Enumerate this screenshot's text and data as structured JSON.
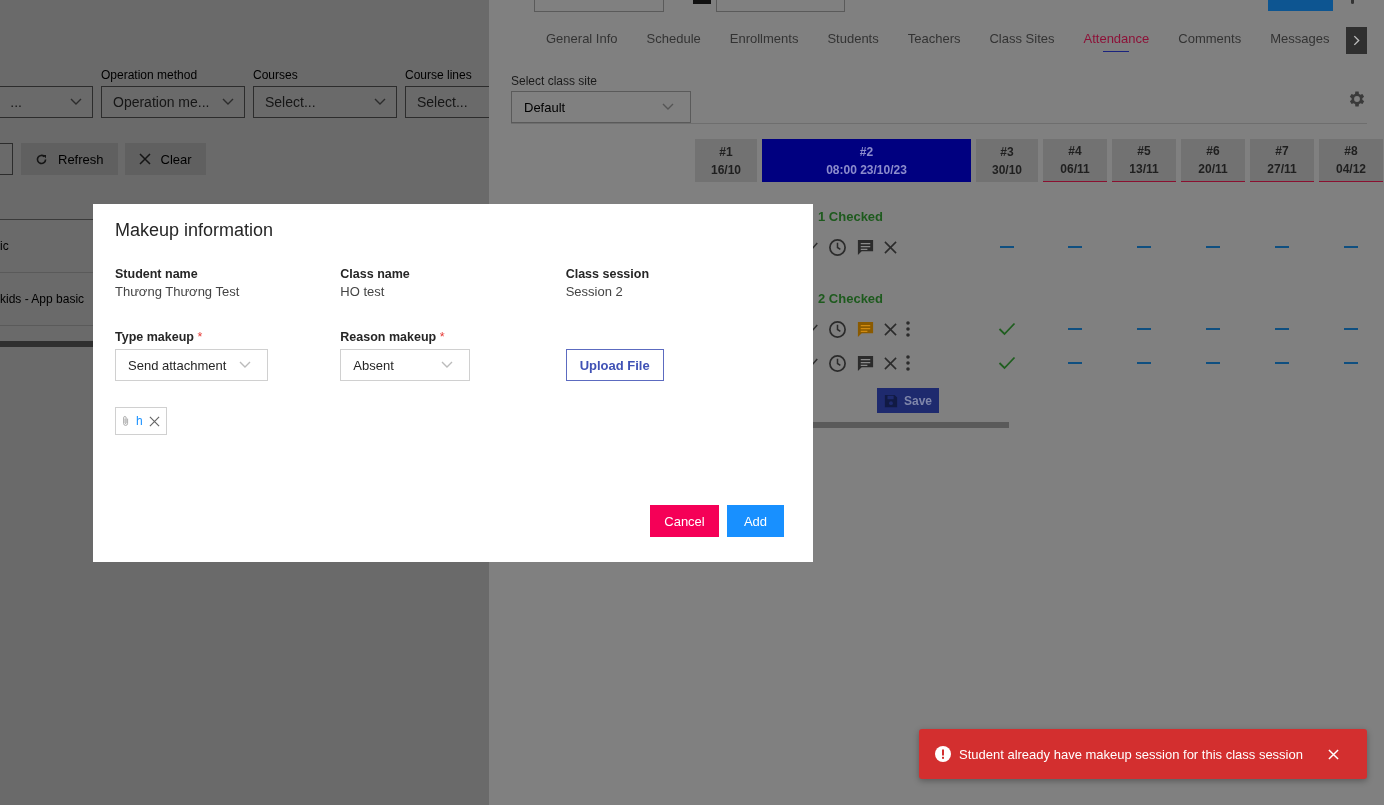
{
  "left_panel": {
    "filters": [
      {
        "placeholder": "..."
      },
      {
        "label": "Operation method",
        "placeholder": "Operation me..."
      },
      {
        "label": "Courses",
        "placeholder": "Select..."
      },
      {
        "label": "Course lines",
        "placeholder": "Select..."
      }
    ],
    "buttons": [
      {
        "kind": "refresh",
        "label": "Refresh"
      },
      {
        "kind": "clear",
        "label": "Clear"
      }
    ],
    "table": {
      "rows": [
        "ic",
        "kids - App basic"
      ]
    }
  },
  "right_panel": {
    "tabs": [
      {
        "label": "General Info",
        "selected": false
      },
      {
        "label": "Schedule",
        "selected": false
      },
      {
        "label": "Enrollments",
        "selected": false
      },
      {
        "label": "Students",
        "selected": false
      },
      {
        "label": "Teachers",
        "selected": false
      },
      {
        "label": "Class Sites",
        "selected": false
      },
      {
        "label": "Attendance",
        "selected": true
      },
      {
        "label": "Comments",
        "selected": false
      },
      {
        "label": "Messages",
        "selected": false
      }
    ],
    "class_site": {
      "label": "Select class site",
      "value": "Default"
    },
    "sessions": [
      {
        "number": "#1",
        "date": "16/10",
        "selected": false,
        "upcoming": false
      },
      {
        "number": "#2",
        "date": "08:00 23/10/23",
        "selected": true,
        "upcoming": false
      },
      {
        "number": "#3",
        "date": "30/10",
        "selected": false,
        "upcoming": false
      },
      {
        "number": "#4",
        "date": "06/11",
        "selected": false,
        "upcoming": true
      },
      {
        "number": "#5",
        "date": "13/11",
        "selected": false,
        "upcoming": true
      },
      {
        "number": "#6",
        "date": "20/11",
        "selected": false,
        "upcoming": true
      },
      {
        "number": "#7",
        "date": "27/11",
        "selected": false,
        "upcoming": true
      },
      {
        "number": "#8",
        "date": "04/12",
        "selected": false,
        "upcoming": true
      }
    ],
    "groups": [
      {
        "summary": "1 Checked",
        "students": [
          {
            "comment_highlighted": false,
            "menu": false,
            "cells": [
              {
                "kind": "dash"
              },
              {
                "kind": "dash"
              },
              {
                "kind": "dash"
              },
              {
                "kind": "dash"
              },
              {
                "kind": "dash"
              },
              {
                "kind": "dash"
              }
            ]
          }
        ]
      },
      {
        "summary": "2 Checked",
        "students": [
          {
            "comment_highlighted": true,
            "menu": true,
            "cells": [
              {
                "kind": "check"
              },
              {
                "kind": "dash"
              },
              {
                "kind": "dash"
              },
              {
                "kind": "dash"
              },
              {
                "kind": "dash"
              },
              {
                "kind": "dash"
              }
            ]
          },
          {
            "comment_highlighted": false,
            "menu": true,
            "cells": [
              {
                "kind": "check"
              },
              {
                "kind": "dash"
              },
              {
                "kind": "dash"
              },
              {
                "kind": "dash"
              },
              {
                "kind": "dash"
              },
              {
                "kind": "dash"
              }
            ]
          }
        ]
      }
    ],
    "save_button": "Save"
  },
  "modal": {
    "title": "Makeup information",
    "info": [
      {
        "label": "Student name",
        "value": "Thương Thương Test"
      },
      {
        "label": "Class name",
        "value": "HO test"
      },
      {
        "label": "Class session",
        "value": "Session 2"
      }
    ],
    "type_makeup": {
      "label": "Type makeup",
      "required_mark": "*",
      "value": "Send attachment"
    },
    "reason_makeup": {
      "label": "Reason makeup",
      "required_mark": "*",
      "value": "Absent"
    },
    "upload_button": "Upload File",
    "attachments": [
      {
        "name": "h"
      }
    ],
    "cancel_button": "Cancel",
    "add_button": "Add"
  },
  "toast": {
    "message": "Student already have makeup session for this class session"
  }
}
